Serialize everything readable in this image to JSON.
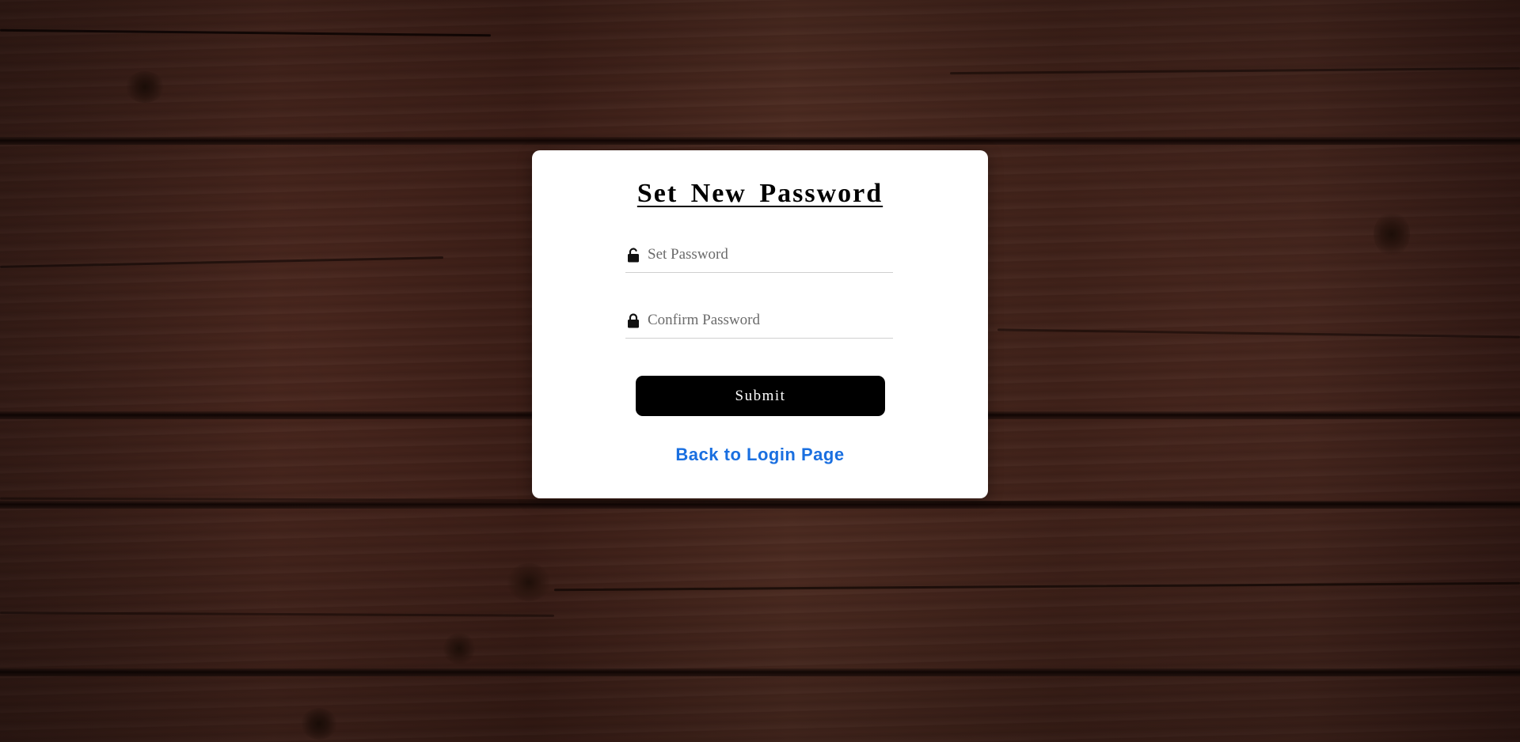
{
  "page": {
    "background": "dark wooden planks"
  },
  "card": {
    "title": "Set New Password",
    "set_password": {
      "placeholder": "Set Password",
      "value": "",
      "icon": "lock-open-icon"
    },
    "confirm_password": {
      "placeholder": "Confirm Password",
      "value": "",
      "icon": "lock-closed-icon"
    },
    "submit_label": "Submit",
    "back_link_label": "Back to Login Page"
  },
  "colors": {
    "card_bg": "#ffffff",
    "button_bg": "#000000",
    "button_text": "#ffffff",
    "link": "#1a6fe0",
    "title": "#000000",
    "wood": "#3b1f18"
  }
}
